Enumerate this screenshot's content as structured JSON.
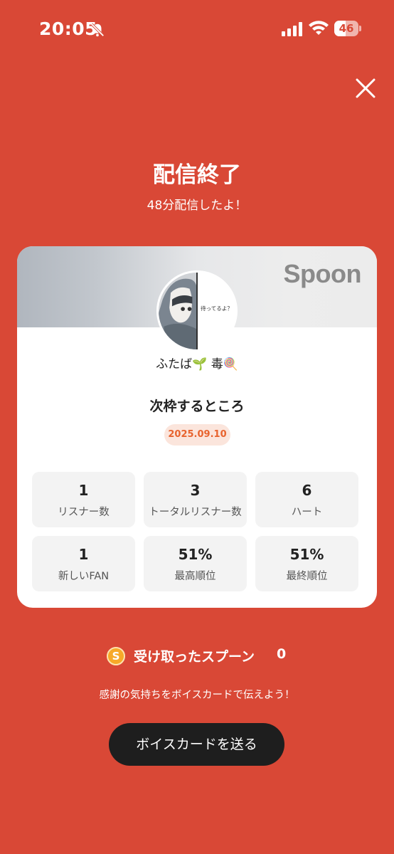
{
  "status_bar": {
    "time": "20:05",
    "battery": "46",
    "icons": [
      "bell-off-icon",
      "signal-icon",
      "wifi-icon",
      "battery-icon"
    ]
  },
  "header": {
    "title": "配信終了",
    "subtitle": "48分配信したよ！",
    "close_icon": "close-icon"
  },
  "card": {
    "brand": "Spoon",
    "username": "ふたば🌱 毒🍭",
    "avatar_caption": "待ってるよ？",
    "stream_title": "次枠するところ",
    "date": "2025.09.10",
    "stats": [
      {
        "value": "1",
        "label": "リスナー数"
      },
      {
        "value": "3",
        "label": "トータルリスナー数"
      },
      {
        "value": "6",
        "label": "ハート"
      },
      {
        "value": "1",
        "label": "新しいFAN"
      },
      {
        "value": "51%",
        "label": "最高順位"
      },
      {
        "value": "51%",
        "label": "最終順位"
      }
    ]
  },
  "spoons": {
    "coin_symbol": "S",
    "label": "受け取ったスプーン",
    "count": "0"
  },
  "thanks_text": "感謝の気持ちをボイスカードで伝えよう！",
  "voice_card_button": "ボイスカードを送る",
  "colors": {
    "background": "#d94836",
    "badge_text": "#e8632e",
    "badge_bg": "#fbe5dc",
    "button_bg": "#1e1e1e",
    "coin": "#f7a928"
  }
}
